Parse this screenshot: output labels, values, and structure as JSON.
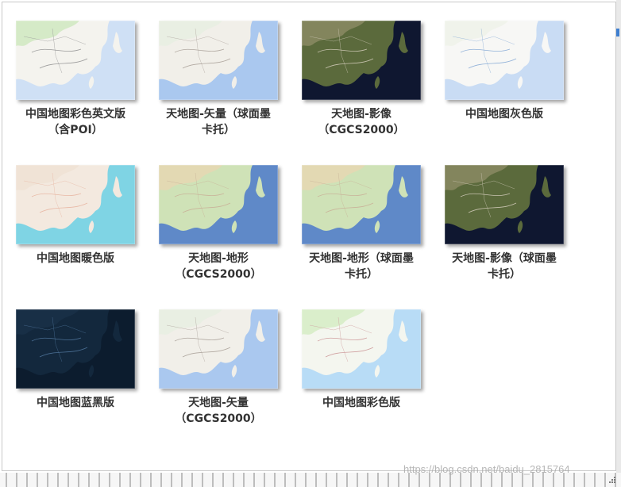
{
  "gallery": {
    "items": [
      {
        "name": "tile-china-color-english",
        "label": [
          "中国地图彩色英文版",
          "（含POI）"
        ],
        "style": "color-en"
      },
      {
        "name": "tile-tianditu-vector-mercator",
        "label": [
          "天地图-矢量（球面墨",
          "卡托）"
        ],
        "style": "vector"
      },
      {
        "name": "tile-tianditu-image-cgcs",
        "label": [
          "天地图-影像",
          "（CGCS2000）"
        ],
        "style": "image"
      },
      {
        "name": "tile-china-gray",
        "label": [
          "中国地图灰色版"
        ],
        "style": "gray"
      },
      {
        "name": "tile-china-warm",
        "label": [
          "中国地图暖色版"
        ],
        "style": "warm"
      },
      {
        "name": "tile-tianditu-terrain-cgcs",
        "label": [
          "天地图-地形",
          "（CGCS2000）"
        ],
        "style": "terrain"
      },
      {
        "name": "tile-tianditu-terrain-mercator",
        "label": [
          "天地图-地形（球面墨",
          "卡托）"
        ],
        "style": "terrain"
      },
      {
        "name": "tile-tianditu-image-mercator",
        "label": [
          "天地图-影像（球面墨",
          "卡托）"
        ],
        "style": "image"
      },
      {
        "name": "tile-china-blue-black",
        "label": [
          "中国地图蓝黑版"
        ],
        "style": "blueblack"
      },
      {
        "name": "tile-tianditu-vector-cgcs",
        "label": [
          "天地图-矢量",
          "（CGCS2000）"
        ],
        "style": "vector"
      },
      {
        "name": "tile-china-color",
        "label": [
          "中国地图彩色版"
        ],
        "style": "color"
      }
    ]
  },
  "watermark": "https://blog.csdn.net/baidu_2815764"
}
